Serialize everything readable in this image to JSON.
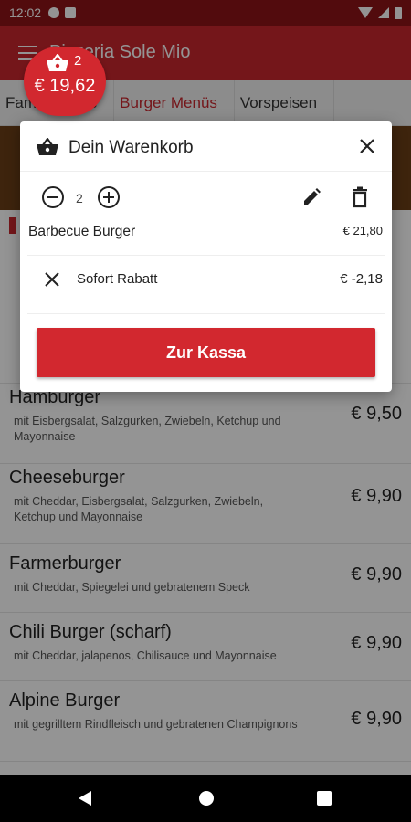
{
  "status_bar": {
    "time": "12:02"
  },
  "app_bar": {
    "title": "Pizzeria Sole Mio"
  },
  "tabs": [
    {
      "label": "Family Meals"
    },
    {
      "label": "Burger Menüs"
    },
    {
      "label": "Vorspeisen"
    }
  ],
  "menu_items": [
    {
      "name": "Hamburger",
      "description": "mit Eisbergsalat, Salzgurken, Zwiebeln, Ketchup und Mayonnaise",
      "price": "€ 9,50"
    },
    {
      "name": "Cheeseburger",
      "description": "mit Cheddar, Eisbergsalat, Salzgurken, Zwiebeln, Ketchup und Mayonnaise",
      "price": "€ 9,90"
    },
    {
      "name": "Farmerburger",
      "description": "mit Cheddar, Spiegelei und gebratenem Speck",
      "price": "€ 9,90"
    },
    {
      "name": "Chili Burger (scharf)",
      "description": "mit Cheddar, jalapenos, Chilisauce und Mayonnaise",
      "price": "€ 9,90"
    },
    {
      "name": "Alpine Burger",
      "description": "mit gegrilltem Rindfleisch und gebratenen Champignons",
      "price": "€ 9,90"
    }
  ],
  "cart_fab": {
    "count": "2",
    "total": "€ 19,62"
  },
  "cart": {
    "title": "Dein Warenkorb",
    "item": {
      "quantity": "2",
      "name": "Barbecue Burger",
      "price": "€ 21,80"
    },
    "discount": {
      "name": "Sofort Rabatt",
      "price": "€ -2,18"
    },
    "checkout_label": "Zur Kassa"
  },
  "colors": {
    "primary": "#d2282f",
    "status_bar": "#8e1317",
    "overlay": "rgba(0,0,0,0.42)"
  },
  "icons": [
    "hamburger-menu-icon",
    "basket-icon",
    "close-icon",
    "minus-circle-icon",
    "plus-circle-icon",
    "edit-pencil-icon",
    "delete-trash-icon",
    "remove-x-icon",
    "nav-back-icon",
    "nav-home-icon",
    "nav-recents-icon"
  ]
}
